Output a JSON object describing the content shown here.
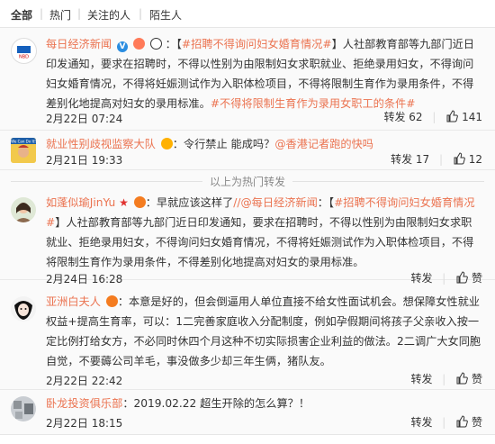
{
  "tabs": [
    "全部",
    "热门",
    "关注的人",
    "陌生人"
  ],
  "comments": [
    {
      "name": "每日经济新闻",
      "sep": "：",
      "text_parts": [
        {
          "t": "【",
          "link": false
        },
        {
          "t": "#招聘不得询问妇女婚育情况#",
          "link": true
        },
        {
          "t": "】人社部教育部等九部门近日印发通知，要求在招聘时，不得以性别为由限制妇女求职就业、拒绝录用妇女，不得询问妇女婚育情况，不得将妊娠测试作为入职体检项目，不得将限制生育作为录用条件，不得差别化地提高对妇女的录用标准。",
          "link": false
        },
        {
          "t": "#不得将限制生育作为录用女职工的条件#",
          "link": true
        }
      ],
      "time": "2月22日 07:24",
      "forward_label": "转发 62",
      "like_count": "141"
    },
    {
      "name": "就业性别歧视监察大队",
      "sep": "：令行禁止 能成吗？",
      "link_text": "@香港记者跑的快吗",
      "time": "2月21日 19:33",
      "forward_label": "转发 17",
      "like_count": "12"
    },
    {
      "name": "如蓬似瑜JinYu",
      "sep": "：早就应该这样了",
      "link_text": "//@每日经济新闻",
      "text_parts": [
        {
          "t": "：【",
          "link": false
        },
        {
          "t": "#招聘不得询问妇女婚育情况#",
          "link": true
        },
        {
          "t": "】人社部教育部等九部门近日印发通知，要求在招聘时，不得以性别为由限制妇女求职就业、拒绝录用妇女，不得询问妇女婚育情况，不得将妊娠测试作为入职体检项目，不得将限制生育作为录用条件，不得差别化地提高对妇女的录用标准。",
          "link": false
        }
      ],
      "time": "2月24日 16:28",
      "forward_label": "转发",
      "like_label": "赞"
    },
    {
      "name": "亚洲白夫人",
      "sep": "：本意是好的，但会倒逼用人单位直接不给女性面试机会。想保障女性就业权益+提高生育率，可以：1二完善家庭收入分配制度，例如孕假期间将孩子父亲收入按一定比例打给女方，不必同时休四个月这种不切实际损害企业利益的做法。2二调广大女同胞自觉，不要薅公司羊毛，事没做多少却三年生俩，猪队友。",
      "time": "2月22日 22:42",
      "forward_label": "转发",
      "like_label": "赞"
    },
    {
      "name": "卧龙投资俱乐部",
      "sep": "：2019.02.22 超生开除的怎么算？！",
      "time": "2月22日 18:15",
      "forward_label": "转发",
      "like_label": "赞"
    }
  ],
  "hot_divider": "以上为热门转发",
  "avatar_texts": {
    "nbd": "NBD",
    "we_can_do_it": "We Can Do It!"
  },
  "colors": {
    "link": "#eb7350",
    "blue_badge": "#2b8de0",
    "text": "#333333"
  }
}
